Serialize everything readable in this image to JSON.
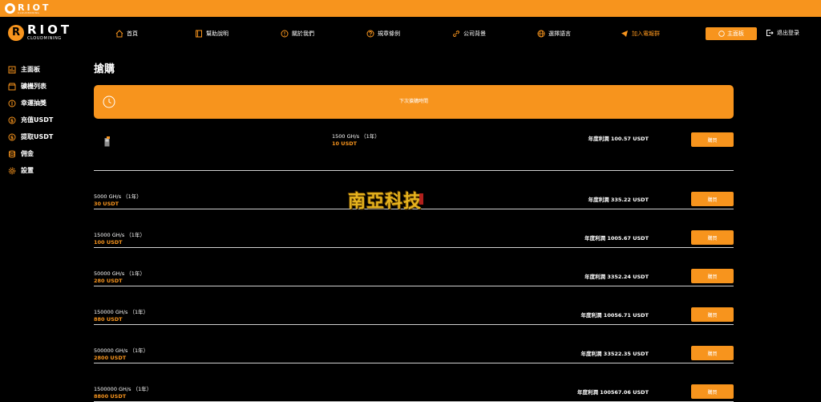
{
  "topbar": {
    "brand": "RIOT",
    "sub": "CLOUDMINING"
  },
  "header": {
    "brand": "RIOT",
    "sub": "CLOUDMINING",
    "nav": [
      {
        "label": "首頁",
        "icon": "home-icon"
      },
      {
        "label": "幫助說明",
        "icon": "help-book-icon"
      },
      {
        "label": "關於我們",
        "icon": "info-icon"
      },
      {
        "label": "規章條例",
        "icon": "question-icon"
      },
      {
        "label": "公司背景",
        "icon": "link-icon"
      },
      {
        "label": "選擇語言",
        "icon": "globe-icon"
      },
      {
        "label": "加入電報群",
        "icon": "telegram-icon"
      }
    ],
    "dashboard_button": "主面板",
    "logout": "退出登录"
  },
  "sidebar": {
    "items": [
      {
        "label": "主面板",
        "icon": "chart-icon"
      },
      {
        "label": "礦機列表",
        "icon": "store-icon"
      },
      {
        "label": "幸運抽獎",
        "icon": "coin-icon"
      },
      {
        "label": "充值USDT",
        "icon": "dollar-icon"
      },
      {
        "label": "提取USDT",
        "icon": "withdraw-icon"
      },
      {
        "label": "佣金",
        "icon": "database-icon"
      },
      {
        "label": "設置",
        "icon": "settings-icon"
      }
    ]
  },
  "main": {
    "title": "搶購",
    "countdown_label": "下次搶購時間",
    "profit_prefix": "年度利潤",
    "buy_label": "購買",
    "rows": [
      {
        "ghs": "1500 GH/s （1年）",
        "price": "10 USDT",
        "profit": "年度利潤 100.57 USDT",
        "buy": "購買"
      },
      {
        "ghs": "5000 GH/s （1年）",
        "price": "30 USDT",
        "profit": "年度利潤 335.22 USDT",
        "buy": "購買"
      },
      {
        "ghs": "15000 GH/s （1年）",
        "price": "100 USDT",
        "profit": "年度利潤 1005.67 USDT",
        "buy": "購買"
      },
      {
        "ghs": "50000 GH/s （1年）",
        "price": "280 USDT",
        "profit": "年度利潤 3352.24 USDT",
        "buy": "購買"
      },
      {
        "ghs": "150000 GH/s （1年）",
        "price": "880 USDT",
        "profit": "年度利潤 10056.71 USDT",
        "buy": "購買"
      },
      {
        "ghs": "500000 GH/s （1年）",
        "price": "2800 USDT",
        "profit": "年度利潤 33522.35 USDT",
        "buy": "購買"
      },
      {
        "ghs": "1500000 GH/s （1年）",
        "price": "8800 USDT",
        "profit": "年度利潤 100567.06 USDT",
        "buy": "購買"
      }
    ]
  },
  "watermark": "南亞科技",
  "colors": {
    "accent": "#f7941d",
    "background": "#000000",
    "text": "#ffffff"
  }
}
